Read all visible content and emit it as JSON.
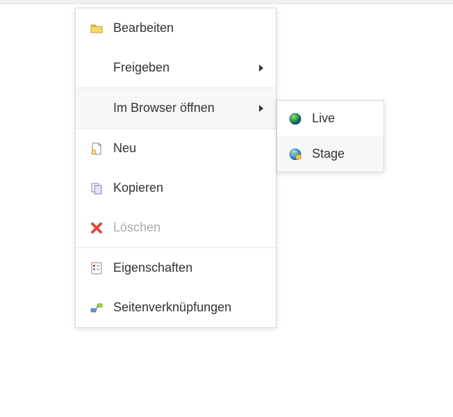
{
  "menu": {
    "edit": {
      "label": "Bearbeiten"
    },
    "share": {
      "label": "Freigeben"
    },
    "open_browser": {
      "label": "Im Browser öffnen"
    },
    "new": {
      "label": "Neu"
    },
    "copy": {
      "label": "Kopieren"
    },
    "delete": {
      "label": "Löschen"
    },
    "properties": {
      "label": "Eigenschaften"
    },
    "page_links": {
      "label": "Seitenverknüpfungen"
    }
  },
  "submenu": {
    "live": {
      "label": "Live"
    },
    "stage": {
      "label": "Stage"
    }
  }
}
